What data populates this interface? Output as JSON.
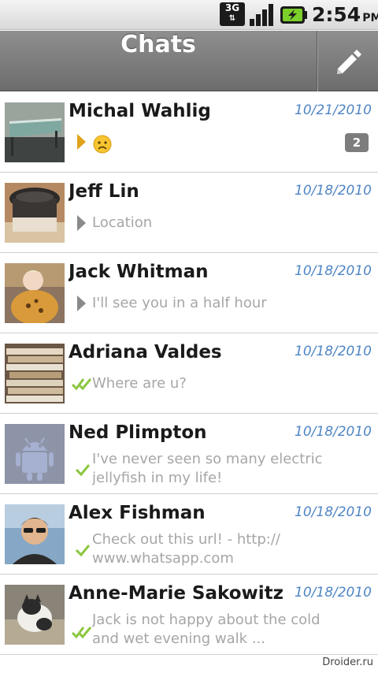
{
  "status_bar": {
    "network_label": "3G",
    "time": "2:54",
    "ampm": "PM"
  },
  "header": {
    "title": "Chats",
    "compose_icon": "pencil-icon"
  },
  "chats": [
    {
      "name": "Michal Wahlig",
      "date": "10/21/2010",
      "message": "",
      "status_icon": "outgoing-arrow-icon",
      "emoji": "sad-face-icon",
      "unread": "2"
    },
    {
      "name": "Jeff Lin",
      "date": "10/18/2010",
      "message": "Location",
      "status_icon": "incoming-arrow-icon"
    },
    {
      "name": "Jack Whitman",
      "date": "10/18/2010",
      "message": "I'll see you in a half hour",
      "status_icon": "incoming-arrow-icon"
    },
    {
      "name": "Adriana Valdes",
      "date": "10/18/2010",
      "message": "Where are u?",
      "status_icon": "double-check-icon"
    },
    {
      "name": "Ned Plimpton",
      "date": "10/18/2010",
      "message": "I've never seen so many electric jellyfish in my life!",
      "status_icon": "check-icon"
    },
    {
      "name": "Alex Fishman",
      "date": "10/18/2010",
      "message": "Check out this url! - http:// www.whatsapp.com",
      "status_icon": "check-icon"
    },
    {
      "name": "Anne-Marie Sakowitz",
      "date": "10/18/2010",
      "message": "Jack is not happy about the cold and wet evening walk ...",
      "status_icon": "double-check-icon"
    }
  ],
  "watermark": "Droider.ru",
  "colors": {
    "date": "#4f85c4",
    "check": "#8cc63f",
    "title_bar": "#7d7d7d",
    "badge": "#7d7d7d"
  }
}
